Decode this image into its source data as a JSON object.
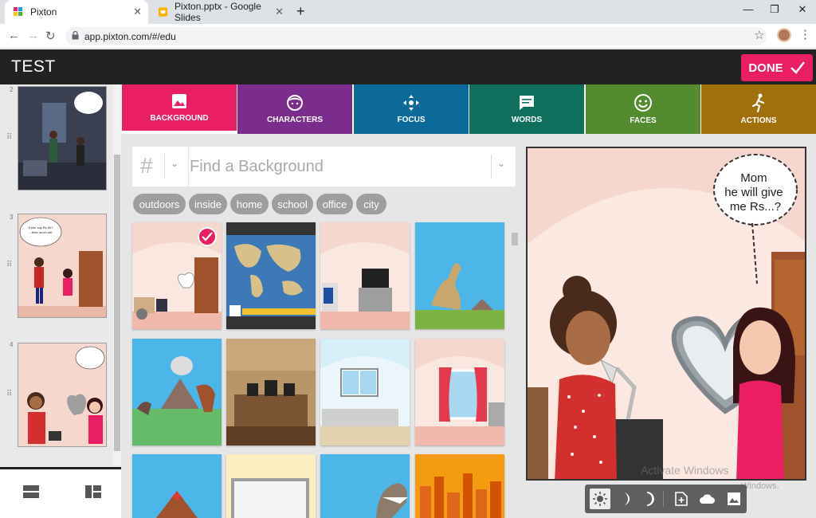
{
  "browser": {
    "tabs": [
      {
        "title": "Pixton",
        "active": true
      },
      {
        "title": "Pixton.pptx - Google Slides",
        "active": false
      }
    ],
    "url": "app.pixton.com/#/edu"
  },
  "app": {
    "title": "TEST",
    "done_label": "DONE"
  },
  "strip": {
    "panels": [
      {
        "number": "2"
      },
      {
        "number": "3",
        "bubble": "If she say Rs 50? to absent from this to 500 rests, then much will be given to me, back?"
      },
      {
        "number": "4",
        "bubble": "Mom he will give me Rs...?"
      }
    ]
  },
  "categories": [
    {
      "label": "BACKGROUND",
      "color": "#e91e63",
      "icon": "image-icon"
    },
    {
      "label": "CHARACTERS",
      "color": "#7b2d8e",
      "icon": "face-icon"
    },
    {
      "label": "FOCUS",
      "color": "#0b6a99",
      "icon": "move-icon"
    },
    {
      "label": "WORDS",
      "color": "#0f6f5c",
      "icon": "speech-icon"
    },
    {
      "label": "FACES",
      "color": "#558b2f",
      "icon": "smiley-icon"
    },
    {
      "label": "ACTIONS",
      "color": "#a0700d",
      "icon": "run-icon"
    }
  ],
  "search": {
    "hash": "#",
    "placeholder": "Find a Background"
  },
  "chips": [
    "outdoors",
    "inside",
    "home",
    "school",
    "office",
    "city"
  ],
  "backgrounds": [
    {
      "name": "bedroom",
      "selected": true
    },
    {
      "name": "world-map"
    },
    {
      "name": "living-room"
    },
    {
      "name": "dinosaur-plain"
    },
    {
      "name": "volcano-dinosaurs"
    },
    {
      "name": "courtroom"
    },
    {
      "name": "bedroom-window"
    },
    {
      "name": "window-curtains"
    },
    {
      "name": "volcano"
    },
    {
      "name": "frame-room"
    },
    {
      "name": "dinosaur-head"
    },
    {
      "name": "city-sunset"
    }
  ],
  "comic": {
    "bubble": "Mom\nhe will give\nme Rs...?"
  },
  "watermark": {
    "line1": "Activate Windows",
    "line2": "Windows."
  },
  "colors": {
    "accent": "#e91e63",
    "header": "#222222"
  }
}
